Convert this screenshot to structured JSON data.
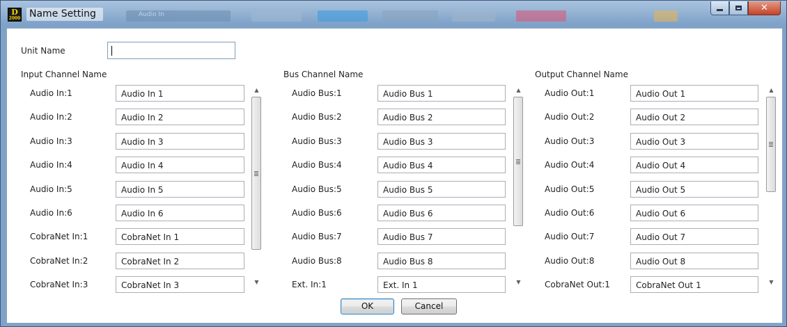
{
  "window": {
    "title": "Name Setting",
    "app_logo_top": "D",
    "app_logo_bottom": "2000",
    "background_text": "Audio In"
  },
  "unit": {
    "label": "Unit Name",
    "value": ""
  },
  "input_group": {
    "title": "Input Channel Name",
    "rows": [
      {
        "label": "Audio In:1",
        "value": "Audio In 1"
      },
      {
        "label": "Audio In:2",
        "value": "Audio In 2"
      },
      {
        "label": "Audio In:3",
        "value": "Audio In 3"
      },
      {
        "label": "Audio In:4",
        "value": "Audio In 4"
      },
      {
        "label": "Audio In:5",
        "value": "Audio In 5"
      },
      {
        "label": "Audio In:6",
        "value": "Audio In 6"
      },
      {
        "label": "CobraNet In:1",
        "value": "CobraNet In 1"
      },
      {
        "label": "CobraNet In:2",
        "value": "CobraNet In 2"
      },
      {
        "label": "CobraNet In:3",
        "value": "CobraNet In 3"
      }
    ]
  },
  "bus_group": {
    "title": "Bus Channel Name",
    "rows": [
      {
        "label": "Audio Bus:1",
        "value": "Audio Bus 1"
      },
      {
        "label": "Audio Bus:2",
        "value": "Audio Bus 2"
      },
      {
        "label": "Audio Bus:3",
        "value": "Audio Bus 3"
      },
      {
        "label": "Audio Bus:4",
        "value": "Audio Bus 4"
      },
      {
        "label": "Audio Bus:5",
        "value": "Audio Bus 5"
      },
      {
        "label": "Audio Bus:6",
        "value": "Audio Bus 6"
      },
      {
        "label": "Audio Bus:7",
        "value": "Audio Bus 7"
      },
      {
        "label": "Audio Bus:8",
        "value": "Audio Bus 8"
      },
      {
        "label": "Ext. In:1",
        "value": "Ext. In 1"
      }
    ]
  },
  "output_group": {
    "title": "Output Channel Name",
    "rows": [
      {
        "label": "Audio Out:1",
        "value": "Audio Out 1"
      },
      {
        "label": "Audio Out:2",
        "value": "Audio Out 2"
      },
      {
        "label": "Audio Out:3",
        "value": "Audio Out 3"
      },
      {
        "label": "Audio Out:4",
        "value": "Audio Out 4"
      },
      {
        "label": "Audio Out:5",
        "value": "Audio Out 5"
      },
      {
        "label": "Audio Out:6",
        "value": "Audio Out 6"
      },
      {
        "label": "Audio Out:7",
        "value": "Audio Out 7"
      },
      {
        "label": "Audio Out:8",
        "value": "Audio Out 8"
      },
      {
        "label": "CobraNet Out:1",
        "value": "CobraNet Out 1"
      }
    ]
  },
  "buttons": {
    "ok": "OK",
    "cancel": "Cancel"
  },
  "icons": {
    "minimize": "minimize-icon",
    "maximize": "maximize-icon",
    "close": "close-icon",
    "scroll_up": "arrow-up-icon",
    "scroll_down": "arrow-down-icon"
  }
}
